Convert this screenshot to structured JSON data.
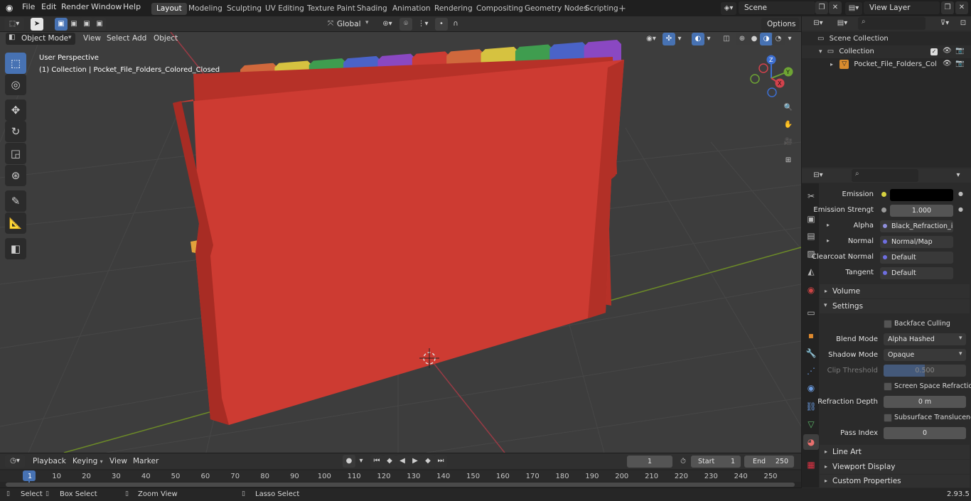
{
  "topbar": {
    "menus": [
      "File",
      "Edit",
      "Render",
      "Window",
      "Help"
    ],
    "workspaces": [
      "Layout",
      "Modeling",
      "Sculpting",
      "UV Editing",
      "Texture Paint",
      "Shading",
      "Animation",
      "Rendering",
      "Compositing",
      "Geometry Nodes",
      "Scripting"
    ],
    "active_workspace": "Layout",
    "scene": "Scene",
    "view_layer": "View Layer"
  },
  "viewport": {
    "mode": "Object Mode",
    "menus": [
      "View",
      "Select",
      "Add",
      "Object"
    ],
    "transform_orientation": "Global",
    "options_label": "Options",
    "perspective": "User Perspective",
    "collection_info": "(1) Collection | Pocket_File_Folders_Colored_Closed",
    "gizmo": {
      "x": "X",
      "y": "Y",
      "z": "Z"
    },
    "tab_colors": [
      "#d0683c",
      "#d6c240",
      "#3f9d4f",
      "#4a63c8",
      "#8a48c2",
      "#cc3b33",
      "#d0683c",
      "#d6c240",
      "#3f9d4f",
      "#4a63c8",
      "#8a48c2"
    ],
    "folder_color": "#cd3b32"
  },
  "outliner": {
    "search_placeholder": "",
    "scene_collection": "Scene Collection",
    "collection": "Collection",
    "object": "Pocket_File_Folders_Colc"
  },
  "properties": {
    "search_placeholder": "",
    "rows": [
      {
        "label": "Emission",
        "value": "",
        "kind": "color"
      },
      {
        "label": "Emission Strengt",
        "value": "1.000",
        "kind": "number"
      },
      {
        "label": "Alpha",
        "value": "Black_Refraction_in...",
        "kind": "link"
      },
      {
        "label": "Normal",
        "value": "Normal/Map",
        "kind": "link"
      },
      {
        "label": "Clearcoat Normal",
        "value": "Default",
        "kind": "link"
      },
      {
        "label": "Tangent",
        "value": "Default",
        "kind": "link"
      }
    ],
    "volume": "Volume",
    "settings": "Settings",
    "backface_culling": "Backface Culling",
    "blend_mode_label": "Blend Mode",
    "blend_mode": "Alpha Hashed",
    "shadow_mode_label": "Shadow Mode",
    "shadow_mode": "Opaque",
    "clip_threshold_label": "Clip Threshold",
    "clip_threshold": "0.500",
    "clip_threshold_fill": 0.5,
    "ssr": "Screen Space Refraction",
    "refraction_depth_label": "Refraction Depth",
    "refraction_depth": "0 m",
    "subsurface": "Subsurface Translucency",
    "pass_index_label": "Pass Index",
    "pass_index": "0",
    "line_art": "Line Art",
    "viewport_display": "Viewport Display",
    "custom_properties": "Custom Properties"
  },
  "timeline": {
    "menus": [
      "Playback",
      "Keying",
      "View",
      "Marker"
    ],
    "current_frame": "1",
    "start_label": "Start",
    "start": "1",
    "end_label": "End",
    "end": "250",
    "ticks": [
      "1",
      "10",
      "20",
      "30",
      "40",
      "50",
      "60",
      "70",
      "80",
      "90",
      "100",
      "110",
      "120",
      "130",
      "140",
      "150",
      "160",
      "170",
      "180",
      "190",
      "200",
      "210",
      "220",
      "230",
      "240",
      "250"
    ]
  },
  "status": {
    "select": "Select",
    "box_select": "Box Select",
    "zoom_view": "Zoom View",
    "lasso_select": "Lasso Select",
    "version": "2.93.5"
  }
}
